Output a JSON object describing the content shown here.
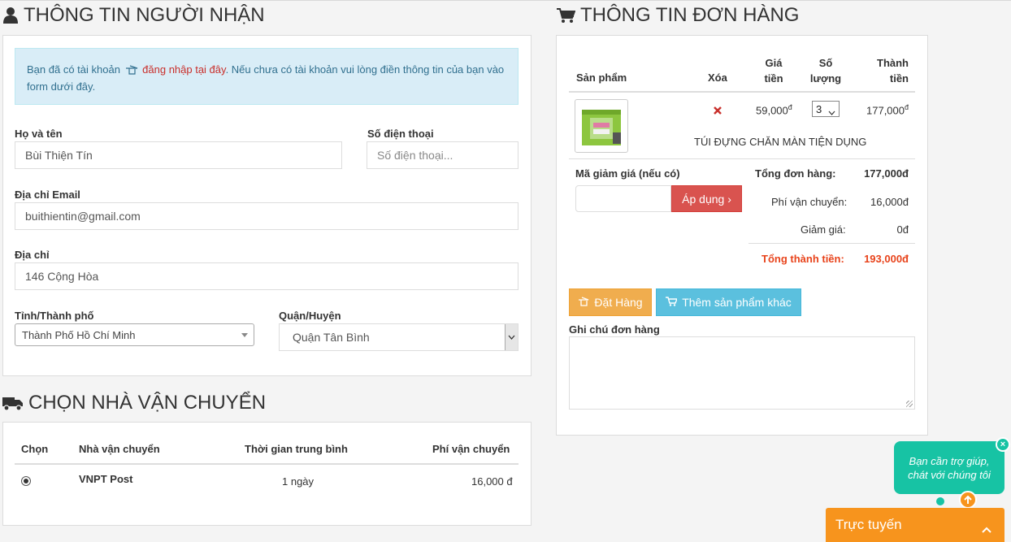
{
  "recipient": {
    "title": "THÔNG TIN NGƯỜI NHẬN",
    "alert": {
      "before": "Bạn đã có tài khoản ",
      "login_link": "đăng nhập tại đây",
      "after": ". Nếu chưa có tài khoản vui lòng điền thông tin của bạn vào form dưới đây."
    },
    "fullname": {
      "label": "Họ và tên",
      "value": "Bùi Thiện Tín"
    },
    "phone": {
      "label": "Số điện thoại",
      "placeholder": "Số điện thoại..."
    },
    "email": {
      "label": "Địa chỉ Email",
      "value": "buithientin@gmail.com"
    },
    "address": {
      "label": "Địa chỉ",
      "value": "146 Cộng Hòa"
    },
    "city": {
      "label": "Tỉnh/Thành phố",
      "value": "Thành Phố Hồ Chí Minh"
    },
    "district": {
      "label": "Quận/Huyện",
      "value": "Quận Tân Bình"
    }
  },
  "shipping": {
    "title": "CHỌN NHÀ VẬN CHUYỂN",
    "columns": [
      "Chọn",
      "Nhà vận chuyển",
      "Thời gian trung bình",
      "Phí vận chuyển"
    ],
    "rows": [
      {
        "carrier": "VNPT Post",
        "time": "1 ngày",
        "fee": "16,000 đ"
      }
    ]
  },
  "order": {
    "title": "THÔNG TIN ĐƠN HÀNG",
    "columns": {
      "product": "Sản phẩm",
      "delete": "Xóa",
      "price_1": "Giá",
      "price_2": "tiền",
      "qty_1": "Số",
      "qty_2": "lượng",
      "total_1": "Thành",
      "total_2": "tiền"
    },
    "item": {
      "name": "TÚI ĐỰNG CHĂN MÀN TIỆN DỤNG",
      "price": "59,000",
      "qty": "3",
      "total": "177,000",
      "currency_sup": "đ",
      "delete_icon": "remove-icon"
    },
    "coupon": {
      "label": "Mã giảm giá (nếu có)",
      "value": "",
      "apply_label": "Áp dụng ›"
    },
    "summary": {
      "subtotal_label": "Tổng đơn hàng:",
      "subtotal": "177,000đ",
      "shipping_label": "Phí vận chuyển:",
      "shipping": "16,000đ",
      "discount_label": "Giảm giá:",
      "discount": "0đ",
      "grand_label": "Tổng thành tiền:",
      "grand": "193,000đ"
    },
    "place_order_label": "Đặt Hàng",
    "add_more_label": "Thêm sản phẩm khác",
    "note_label": "Ghi chú đơn hàng",
    "note_value": ""
  },
  "chat": {
    "bubble_line1": "Bạn cần trợ giúp,",
    "bubble_line2": "chát với chúng tôi",
    "close_glyph": "×",
    "online_label": "Trực tuyến"
  },
  "colors": {
    "accent_red": "#d9534f",
    "total_red": "#e8431b",
    "order_orange": "#f0ad4e",
    "info_blue": "#5bc0de",
    "chat_teal": "#17c3a4",
    "chat_orange": "#f7941d"
  }
}
